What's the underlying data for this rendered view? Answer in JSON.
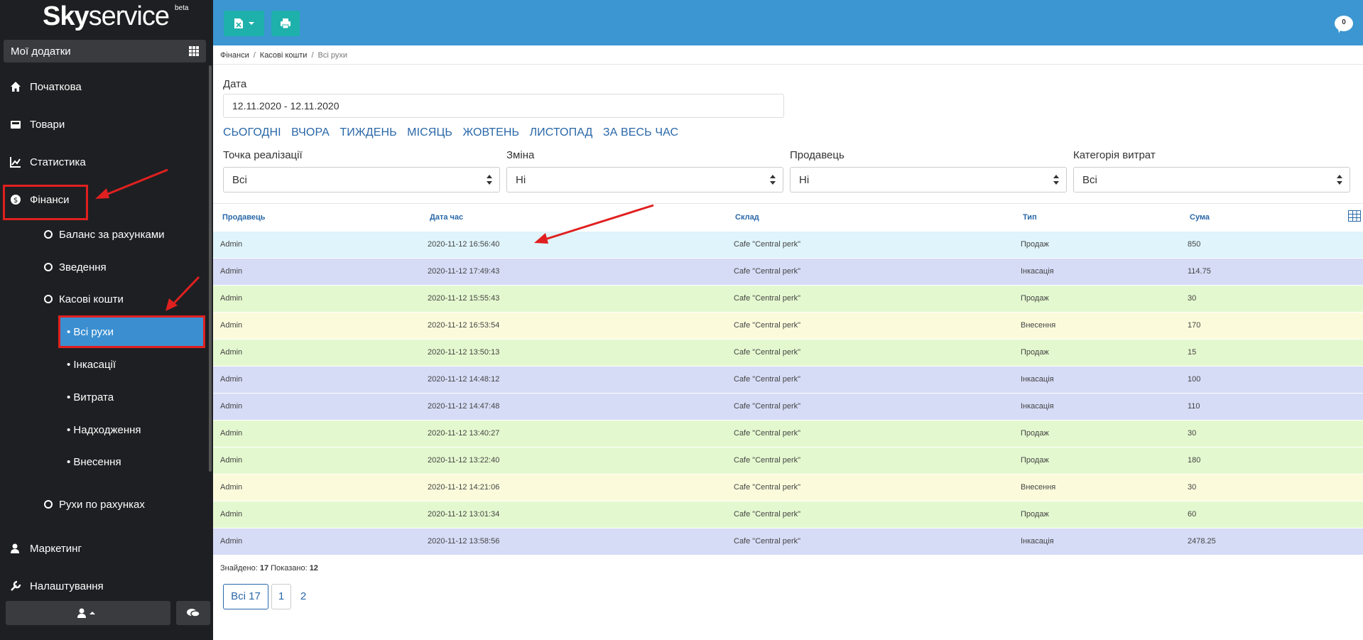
{
  "brand": {
    "name_bold": "Sky",
    "name_light": "service",
    "badge": "beta"
  },
  "apps_bar": {
    "label": "Мої додатки"
  },
  "sidebar": {
    "main": [
      {
        "label": "Початкова",
        "icon": "home-icon"
      },
      {
        "label": "Товари",
        "icon": "box-icon"
      },
      {
        "label": "Статистика",
        "icon": "chart-icon"
      },
      {
        "label": "Фінанси",
        "icon": "dollar-icon"
      },
      {
        "label": "Маркетинг",
        "icon": "users-icon"
      },
      {
        "label": "Налаштування",
        "icon": "wrench-icon"
      }
    ],
    "finance_sub": [
      {
        "label": "Баланс за рахунками"
      },
      {
        "label": "Зведення"
      },
      {
        "label": "Касові кошти"
      },
      {
        "label": "Рухи по рахунках"
      }
    ],
    "cash_sub": [
      {
        "label": "• Всі рухи"
      },
      {
        "label": "• Інкасації"
      },
      {
        "label": "• Витрата"
      },
      {
        "label": "• Надходження"
      },
      {
        "label": "• Внесення"
      }
    ]
  },
  "topbar": {
    "chat_count": "0"
  },
  "breadcrumb": {
    "level1": "Фінанси",
    "level2": "Касові кошти",
    "current": "Всі рухи"
  },
  "filters": {
    "date_label": "Дата",
    "date_value": "12.11.2020 - 12.11.2020",
    "quick": [
      "СЬОГОДНІ",
      "ВЧОРА",
      "ТИЖДЕНЬ",
      "МІСЯЦЬ",
      "ЖОВТЕНЬ",
      "ЛИСТОПАД",
      "ЗА ВЕСЬ ЧАС"
    ],
    "point": {
      "label": "Точка реалізації",
      "value": "Всі"
    },
    "shift": {
      "label": "Зміна",
      "value": "Ні"
    },
    "seller": {
      "label": "Продавець",
      "value": "Ні"
    },
    "expense_cat": {
      "label": "Категорія витрат",
      "value": "Всі"
    }
  },
  "table": {
    "headers": [
      "Продавець",
      "Дата час",
      "Склад",
      "Тип",
      "Сума"
    ],
    "rows": [
      {
        "seller": "Admin",
        "datetime": "2020-11-12 16:56:40",
        "store": "Cafe \"Central perk\"",
        "type": "Продаж",
        "sum": "850",
        "color": "#dff4fb"
      },
      {
        "seller": "Admin",
        "datetime": "2020-11-12 17:49:43",
        "store": "Cafe \"Central perk\"",
        "type": "Інкасація",
        "sum": "114.75",
        "color": "#d6dcf6"
      },
      {
        "seller": "Admin",
        "datetime": "2020-11-12 15:55:43",
        "store": "Cafe \"Central perk\"",
        "type": "Продаж",
        "sum": "30",
        "color": "#e4f8cf"
      },
      {
        "seller": "Admin",
        "datetime": "2020-11-12 16:53:54",
        "store": "Cafe \"Central perk\"",
        "type": "Внесення",
        "sum": "170",
        "color": "#fbfbdc"
      },
      {
        "seller": "Admin",
        "datetime": "2020-11-12 13:50:13",
        "store": "Cafe \"Central perk\"",
        "type": "Продаж",
        "sum": "15",
        "color": "#e4f8cf"
      },
      {
        "seller": "Admin",
        "datetime": "2020-11-12 14:48:12",
        "store": "Cafe \"Central perk\"",
        "type": "Інкасація",
        "sum": "100",
        "color": "#d6dcf6"
      },
      {
        "seller": "Admin",
        "datetime": "2020-11-12 14:47:48",
        "store": "Cafe \"Central perk\"",
        "type": "Інкасація",
        "sum": "110",
        "color": "#d6dcf6"
      },
      {
        "seller": "Admin",
        "datetime": "2020-11-12 13:40:27",
        "store": "Cafe \"Central perk\"",
        "type": "Продаж",
        "sum": "30",
        "color": "#e4f8cf"
      },
      {
        "seller": "Admin",
        "datetime": "2020-11-12 13:22:40",
        "store": "Cafe \"Central perk\"",
        "type": "Продаж",
        "sum": "180",
        "color": "#e4f8cf"
      },
      {
        "seller": "Admin",
        "datetime": "2020-11-12 14:21:06",
        "store": "Cafe \"Central perk\"",
        "type": "Внесення",
        "sum": "30",
        "color": "#fbfbdc"
      },
      {
        "seller": "Admin",
        "datetime": "2020-11-12 13:01:34",
        "store": "Cafe \"Central perk\"",
        "type": "Продаж",
        "sum": "60",
        "color": "#e4f8cf"
      },
      {
        "seller": "Admin",
        "datetime": "2020-11-12 13:58:56",
        "store": "Cafe \"Central perk\"",
        "type": "Інкасація",
        "sum": "2478.25",
        "color": "#d6dcf6"
      }
    ]
  },
  "summary": {
    "found_label": "Знайдено:",
    "found": "17",
    "shown_label": "Показано:",
    "shown": "12"
  },
  "pager": {
    "all": "Всі 17",
    "page1": "1",
    "page2": "2"
  },
  "colors": {
    "sidebar_bg": "#1e1f22",
    "topbar_bg": "#3b96d2",
    "active_item": "#3b8fd1",
    "action_btn": "#1eb1ab",
    "link": "#2a68a8",
    "annotation": "#e02020"
  }
}
